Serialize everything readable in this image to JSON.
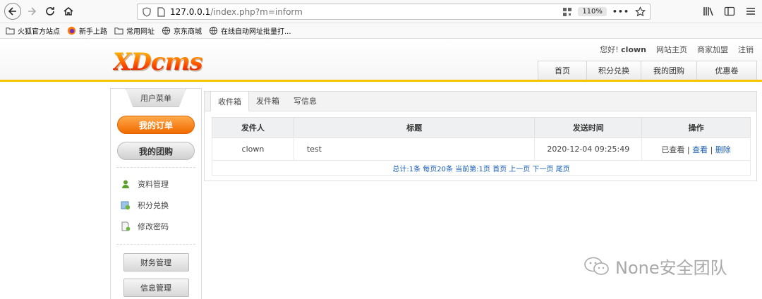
{
  "browser": {
    "url_host": "127.0.0.1",
    "url_path": "/index.php?m=inform",
    "zoom": "110%"
  },
  "bookmarks": [
    {
      "label": "火狐官方站点",
      "icon": "folder-icon"
    },
    {
      "label": "新手上路",
      "icon": "firefox-icon"
    },
    {
      "label": "常用网址",
      "icon": "folder-icon"
    },
    {
      "label": "京东商城",
      "icon": "globe-icon"
    },
    {
      "label": "在线自动网址批量打...",
      "icon": "globe-icon"
    }
  ],
  "header": {
    "logo": "XDcms",
    "greeting": "您好!",
    "username": "clown",
    "links": [
      "网站主页",
      "商家加盟",
      "注销"
    ],
    "nav": [
      "首页",
      "积分兑换",
      "我的团购",
      "优惠卷"
    ]
  },
  "sidebar": {
    "title": "用户菜单",
    "primary_btn": "我的订单",
    "secondary_btn": "我的团购",
    "links": [
      {
        "label": "资料管理",
        "icon": "user-icon"
      },
      {
        "label": "积分兑换",
        "icon": "exchange-icon"
      },
      {
        "label": "修改密码",
        "icon": "edit-icon"
      }
    ],
    "buttons": [
      "财务管理",
      "信息管理"
    ]
  },
  "tabs": [
    "收件箱",
    "发件箱",
    "写信息"
  ],
  "table": {
    "headers": [
      "发件人",
      "标题",
      "发送时间",
      "操作"
    ],
    "rows": [
      {
        "sender": "clown",
        "title": "test",
        "time": "2020-12-04 09:25:49",
        "status": "已查看",
        "sep1": "|",
        "view": "查看",
        "sep2": "|",
        "delete": "删除"
      }
    ],
    "pager": "总计:1条 每页20条 当前第:1页 首页 上一页 下一页 尾页"
  },
  "watermark": "None安全团队",
  "colors": {
    "accent": "#f7c400",
    "orange": "#f06a00",
    "link": "#1a5fb4"
  }
}
